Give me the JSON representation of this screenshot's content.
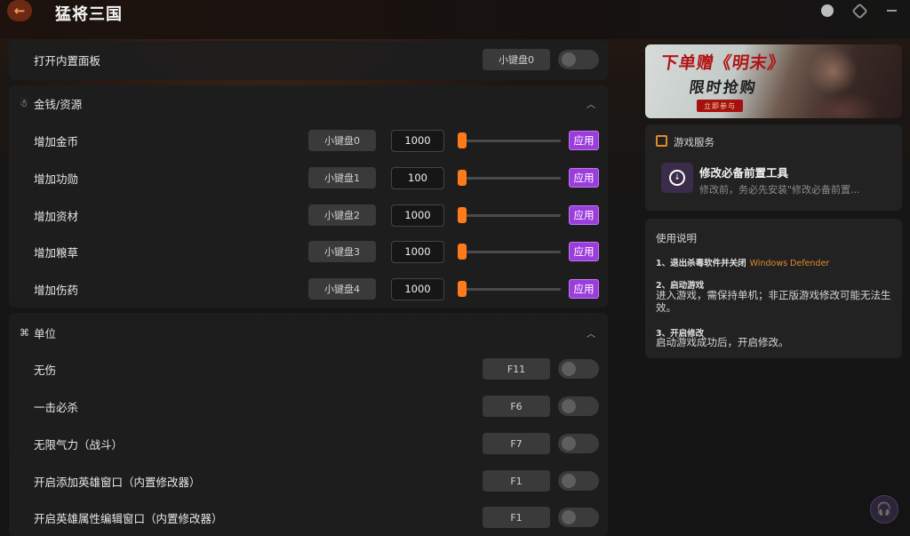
{
  "app": {
    "title": "猛将三国"
  },
  "titlebar": {
    "back_icon": "arrow-left-icon",
    "icons": [
      "user-icon",
      "settings-icon",
      "minimize-icon"
    ]
  },
  "top_row": {
    "label": "打开内置面板",
    "key": "小键盘0",
    "enabled": false
  },
  "sections": [
    {
      "title": "金钱/资源",
      "icon": "bag-icon",
      "expanded": true,
      "rows": [
        {
          "label": "增加金币",
          "key": "小键盘0",
          "value": "1000",
          "slider": 0,
          "apply": "应用"
        },
        {
          "label": "增加功勋",
          "key": "小键盘1",
          "value": "100",
          "slider": 0,
          "apply": "应用"
        },
        {
          "label": "增加资材",
          "key": "小键盘2",
          "value": "1000",
          "slider": 0,
          "apply": "应用"
        },
        {
          "label": "增加粮草",
          "key": "小键盘3",
          "value": "1000",
          "slider": 0,
          "apply": "应用"
        },
        {
          "label": "增加伤药",
          "key": "小键盘4",
          "value": "1000",
          "slider": 0,
          "apply": "应用"
        }
      ]
    },
    {
      "title": "单位",
      "icon": "unit-icon",
      "expanded": true,
      "rows": [
        {
          "label": "无伤",
          "key": "F11",
          "enabled": false
        },
        {
          "label": "一击必杀",
          "key": "F6",
          "enabled": false
        },
        {
          "label": "无限气力（战斗）",
          "key": "F7",
          "enabled": false
        },
        {
          "label": "开启添加英雄窗口（内置修改器）",
          "key": "F1",
          "enabled": false
        },
        {
          "label": "开启英雄属性编辑窗口（内置修改器）",
          "key": "F1",
          "enabled": false
        }
      ]
    }
  ],
  "banner": {
    "title": "下单赠《明末》",
    "subtitle": "限时抢购",
    "cta": "立即参与"
  },
  "service": {
    "heading": "游戏服务",
    "item_title": "修改必备前置工具",
    "item_desc": "修改前，务必先安装\"修改必备前置..."
  },
  "guide": {
    "heading": "使用说明",
    "steps": [
      {
        "title": "1、退出杀毒软件并关闭",
        "highlight": "Windows Defender",
        "body": ""
      },
      {
        "title": "2、启动游戏",
        "body": "进入游戏，需保持单机；非正版游戏修改可能无法生效。"
      },
      {
        "title": "3、开启修改",
        "body": "启动游戏成功后，开启修改。"
      }
    ]
  },
  "colors": {
    "accent": "#ff7a1a",
    "apply": "#9b3ddb",
    "highlight": "#e08a2a"
  }
}
